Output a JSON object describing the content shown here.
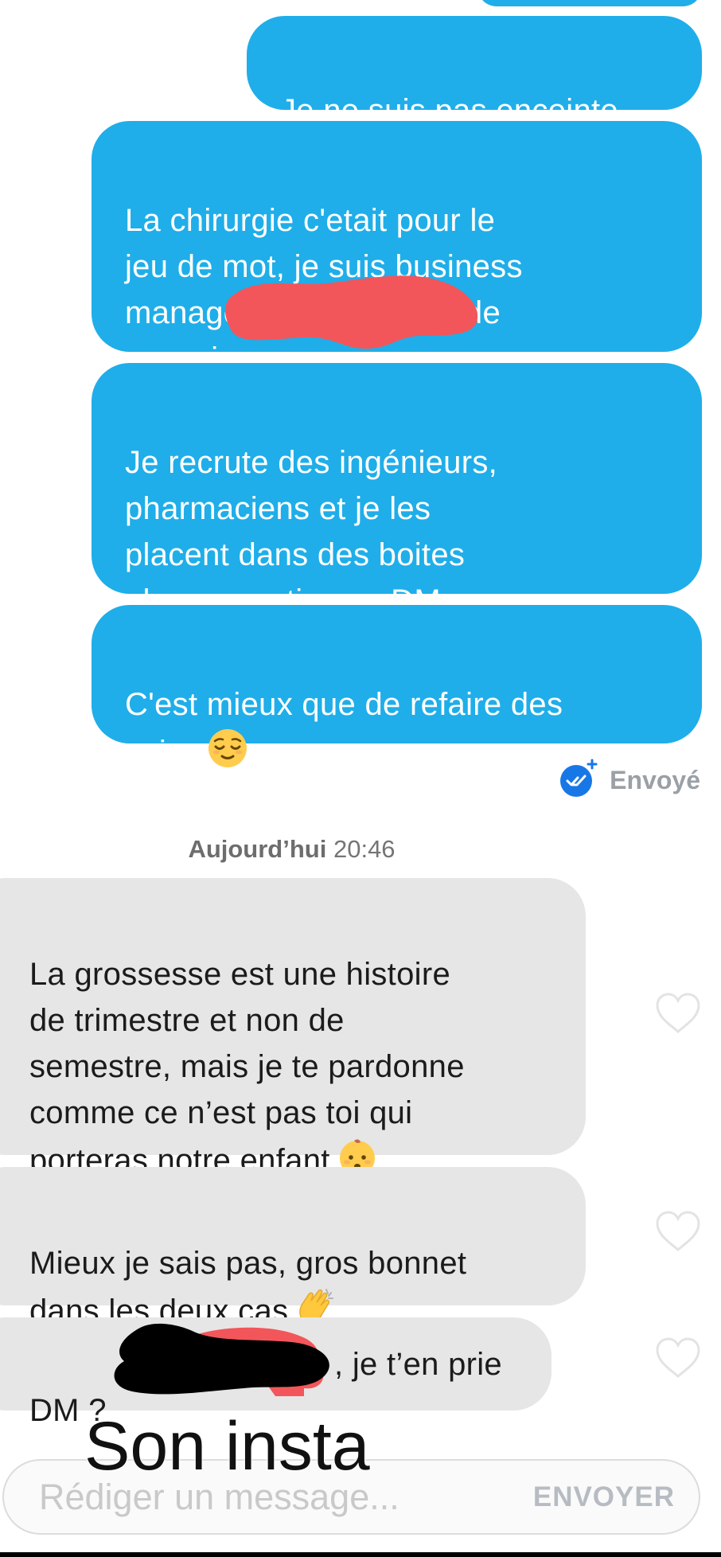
{
  "conversation": {
    "sent_messages": [
      "Je ne suis pas enceinte",
      "La chirurgie c'etait pour le\njeu de mot, je suis business\nmanager dans un boite de\nconsei",
      "Je recrute des ingénieurs,\npharmaciens et je les\nplacent dans des boites\npharmaceutiques, DM",
      "C'est mieux que de refaire des\nseins"
    ],
    "status_label": "Envoyé",
    "day_separator": {
      "day": "Aujourd’hui",
      "time": "20:46"
    },
    "received_messages": [
      "La grossesse est une histoire\nde trimestre et non de\nsemestre, mais je te pardonne\ncomme ce n’est pas toi qui\nporteras notre enfant",
      "Mieux je sais pas, gros bonnet\ndans les deux cas",
      "DM ?"
    ],
    "received_tail_3": ", je t’en prie",
    "emojis": {
      "sent_4": "relieved-face",
      "received_1": "baby-face",
      "received_2": "clapping-hands"
    }
  },
  "overlay": {
    "caption": "Son insta"
  },
  "composer": {
    "placeholder": "Rédiger un message...",
    "send_label": "ENVOYER"
  },
  "colors": {
    "sent_bubble": "#1faee9",
    "received_bubble": "#e6e6e6",
    "status_check": "#1877e6",
    "redaction_red": "#f2565a"
  }
}
